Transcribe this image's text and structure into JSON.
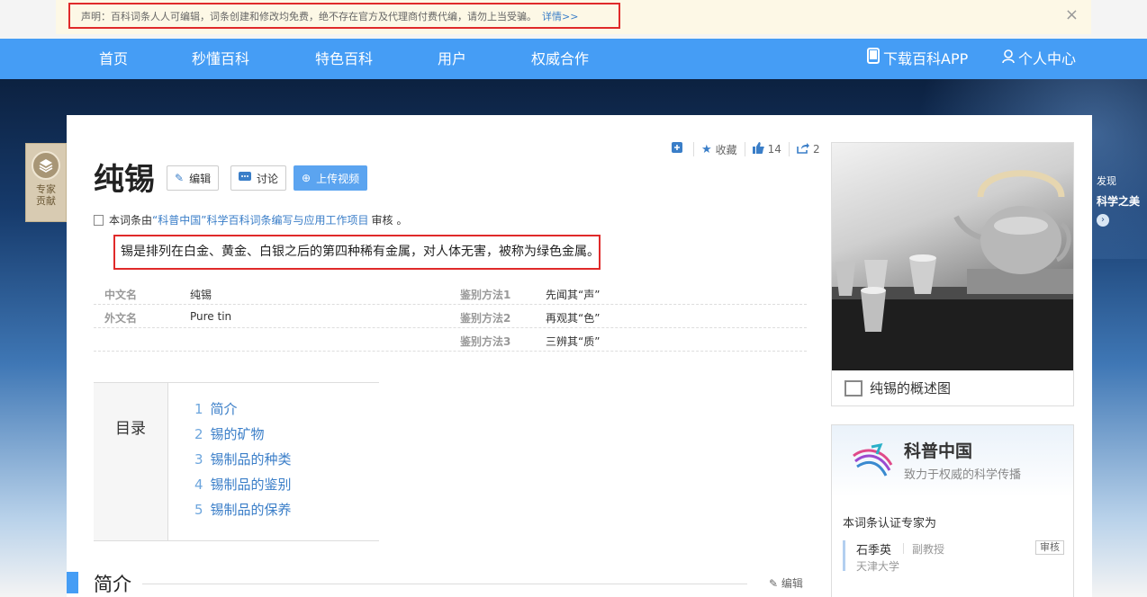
{
  "notice": {
    "text": "声明：百科词条人人可编辑，词条创建和修改均免费，绝不存在官方及代理商付费代编，请勿上当受骗。",
    "more": "详情>>",
    "close": "×"
  },
  "nav": {
    "items": [
      "首页",
      "秒懂百科",
      "特色百科",
      "用户",
      "权威合作"
    ],
    "app": "下载百科APP",
    "user": "个人中心"
  },
  "expert_badge": {
    "line1": "专家",
    "line2": "贡献"
  },
  "side_promo": {
    "line1": "发现",
    "line2": "科学之美"
  },
  "toolbar": {
    "collect": "收藏",
    "like_count": "14",
    "share_count": "2"
  },
  "title": "纯锡",
  "buttons": {
    "edit": "编辑",
    "discuss": "讨论",
    "upload": "上传视频"
  },
  "review": {
    "prefix": "本词条由",
    "link": "“科普中国”科学百科词条编写与应用工作项目",
    "suffix": "审核",
    "end": "。"
  },
  "summary": "锡是排列在白金、黄金、白银之后的第四种稀有金属，对人体无害，被称为绿色金属。",
  "infobox": {
    "rows": [
      {
        "k1": "中文名",
        "v1": "纯锡",
        "k2": "鉴别方法1",
        "v2": "先闻其“声”"
      },
      {
        "k1": "外文名",
        "v1": "Pure tin",
        "k2": "鉴别方法2",
        "v2": "再观其“色”"
      },
      {
        "k1": "",
        "v1": "",
        "k2": "鉴别方法3",
        "v2": "三辨其“质”"
      }
    ]
  },
  "toc": {
    "label": "目录",
    "items": [
      {
        "num": "1",
        "text": "简介"
      },
      {
        "num": "2",
        "text": "锡的矿物"
      },
      {
        "num": "3",
        "text": "锡制品的种类"
      },
      {
        "num": "4",
        "text": "锡制品的鉴别"
      },
      {
        "num": "5",
        "text": "锡制品的保养"
      }
    ]
  },
  "section": {
    "title": "简介",
    "edit": "编辑"
  },
  "album": {
    "caption": "纯锡的概述图"
  },
  "kepu": {
    "name": "科普中国",
    "desc": "致力于权威的科学传播",
    "certify": "本词条认证专家为",
    "expert_name": "石季英",
    "expert_title": "副教授",
    "expert_org": "天津大学",
    "tag": "审核"
  },
  "colors": {
    "nav": "#459df5",
    "highlight": "#e02a2a",
    "link": "#3a7ec8"
  }
}
